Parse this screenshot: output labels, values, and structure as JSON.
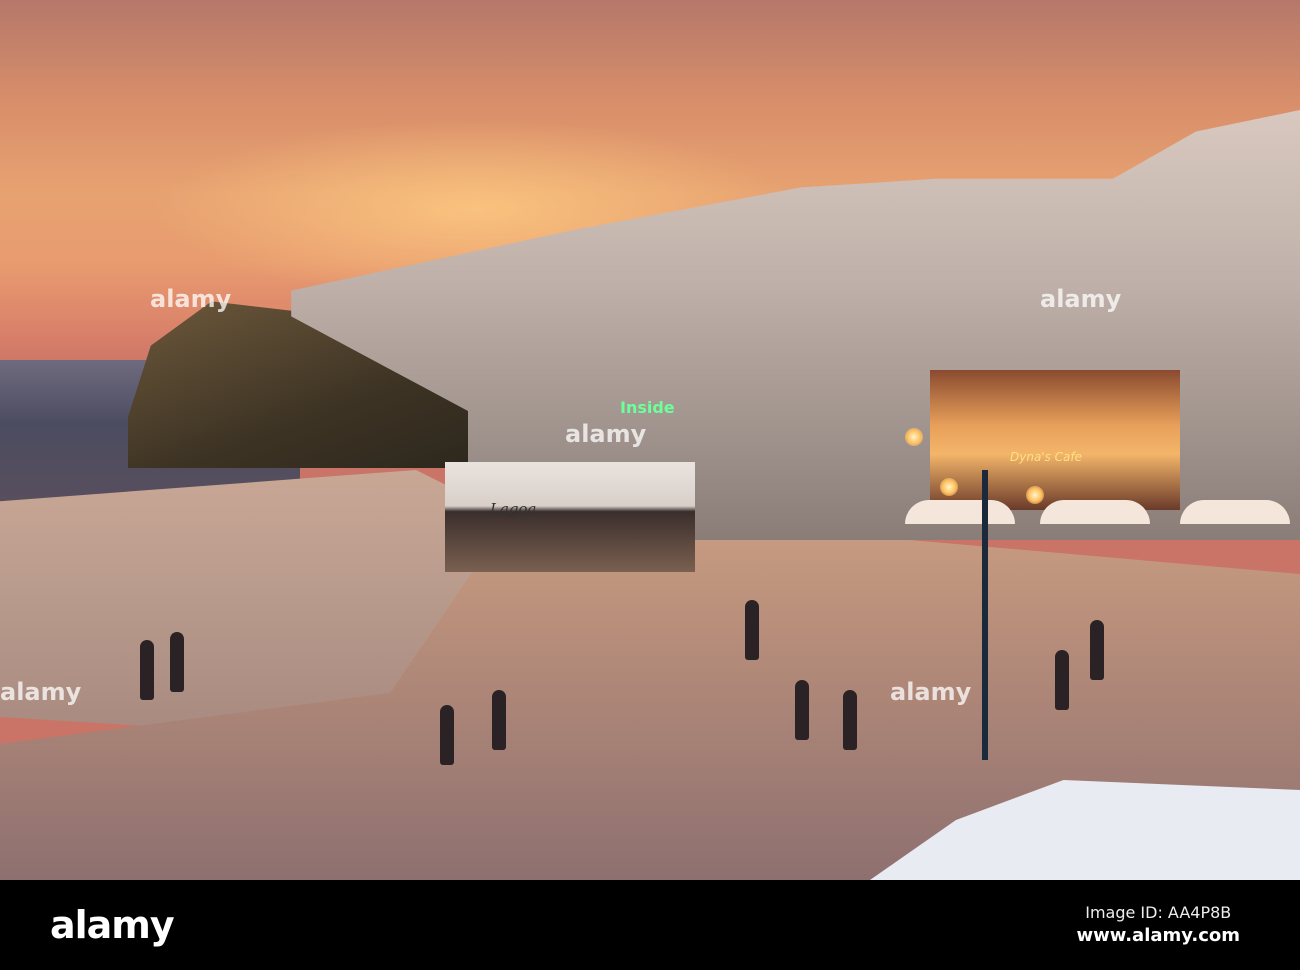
{
  "photo": {
    "watermark_text": "alamy"
  },
  "footer": {
    "logo": "alamy",
    "image_id": "Image ID: AA4P8B",
    "url": "www.alamy.com"
  },
  "signs": {
    "stage_sign": "Lagoa",
    "club_sign": "Inside",
    "cafe_sign": "Dyna's Cafe"
  }
}
